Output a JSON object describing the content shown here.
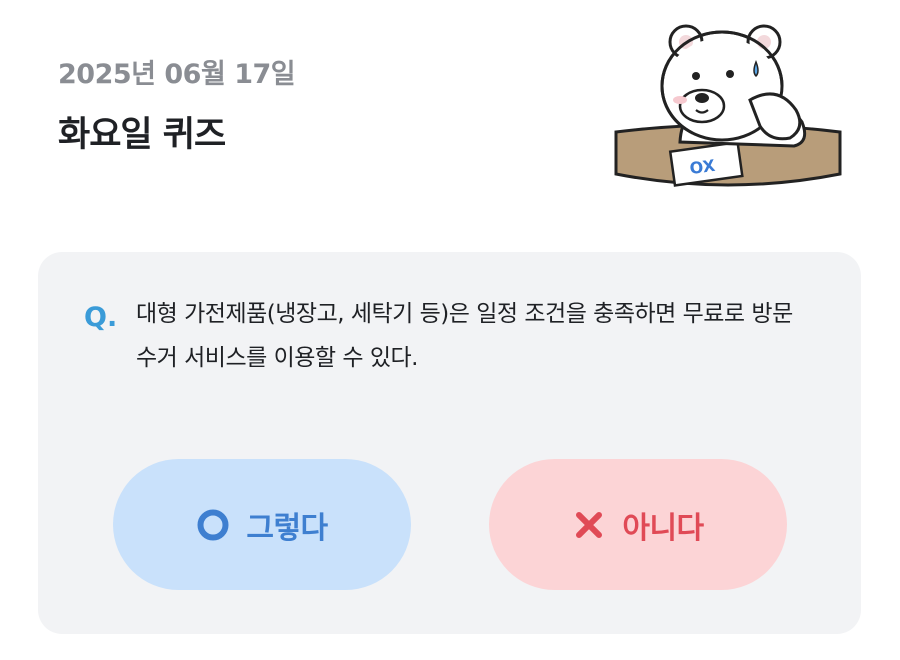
{
  "header": {
    "date": "2025년 06월 17일",
    "title": "화요일 퀴즈"
  },
  "mascot": {
    "icon": "polar-bear-thinking-icon",
    "card_text": "OX"
  },
  "quiz": {
    "q_label": "Q.",
    "question": "대형 가전제품(냉장고, 세탁기 등)은 일정 조건을 충족하면 무료로 방문 수거 서비스를 이용할 수 있다."
  },
  "answers": {
    "yes": {
      "label": "그렇다",
      "icon": "circle-o-icon",
      "color": "#3e7fd0",
      "background": "#c9e1fb"
    },
    "no": {
      "label": "아니다",
      "icon": "cross-x-icon",
      "color": "#e04a56",
      "background": "#fcd4d6"
    }
  },
  "colors": {
    "accent": "#3a9bd8",
    "card_background": "#f2f3f5"
  }
}
